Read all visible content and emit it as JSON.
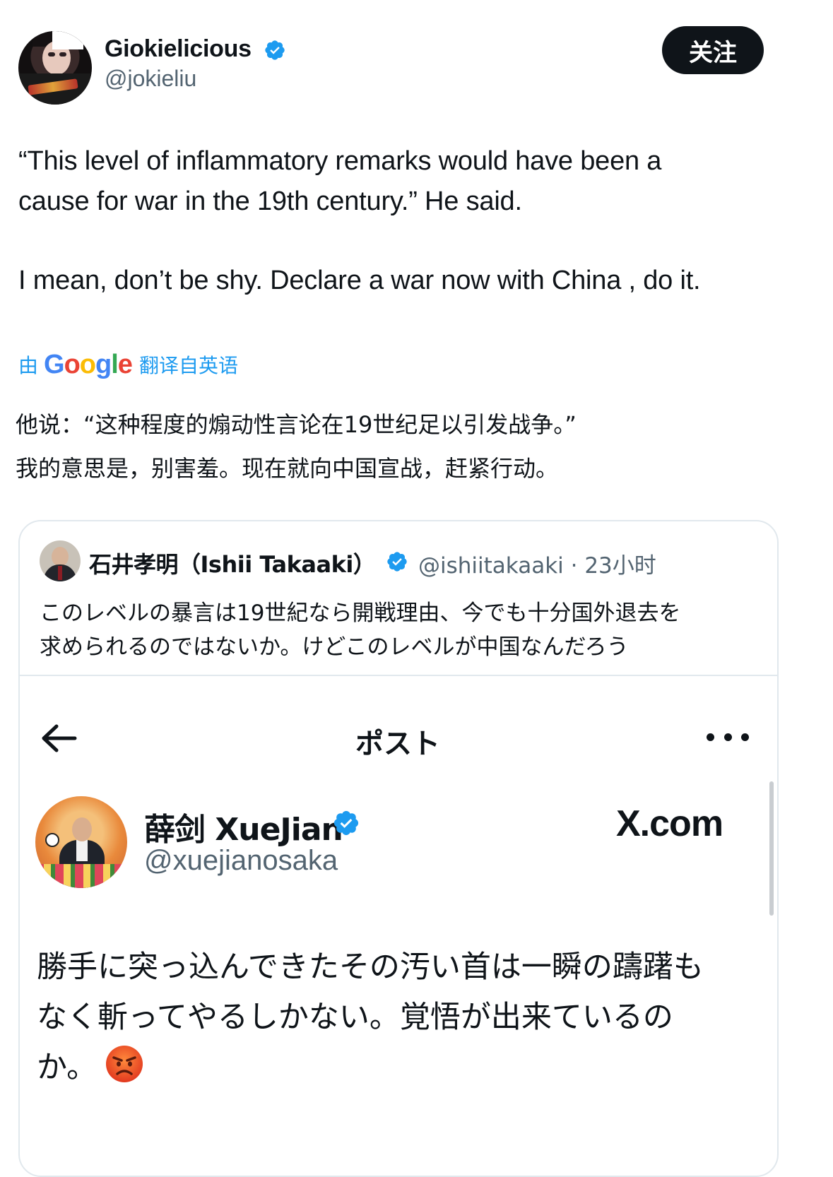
{
  "author": {
    "display_name": "Giokielicious",
    "handle": "@jokieliu",
    "verified": true
  },
  "follow_button": {
    "label": "关注"
  },
  "tweet": {
    "lines": [
      "“This level of inflammatory remarks would have been a",
      "cause for war in the 19th century.” He said.",
      "I mean, don’t be shy. Declare a war now with China , do it."
    ]
  },
  "translation": {
    "prefix": "由",
    "google_letters": [
      "G",
      "o",
      "o",
      "g",
      "l",
      "e"
    ],
    "suffix": "翻译自英语",
    "lines": [
      "他说：“这种程度的煽动性言论在19世纪足以引发战争。”",
      "我的意思是，别害羞。现在就向中国宣战，赶紧行动。"
    ]
  },
  "quoted_post": {
    "display_name": "石井孝明（Ishii Takaaki）",
    "handle": "@ishiitakaaki",
    "time": "· 23小时",
    "verified": true,
    "lines": [
      "このレベルの暴言は19世紀なら開戦理由、今でも十分国外退去を",
      "求められるのではないか。けどこのレベルが中国なんだろう"
    ]
  },
  "embedded_screenshot": {
    "header_title": "ポスト",
    "display_name": "薛剑 XueJian",
    "handle": "@xuejianosaka",
    "verified": true,
    "watermark": "X.com",
    "lines": [
      "勝手に突っ込んできたその汚い首は一瞬の躊躇も",
      "なく斬ってやるしかない。覚悟が出来ているの",
      "か。"
    ],
    "emoji": "angry-face"
  },
  "colors": {
    "verified_blue": "#1d9bf0",
    "text_primary": "#0f1419",
    "text_secondary": "#536471",
    "border": "#e1e8ed",
    "follow_bg": "#0f1419"
  }
}
